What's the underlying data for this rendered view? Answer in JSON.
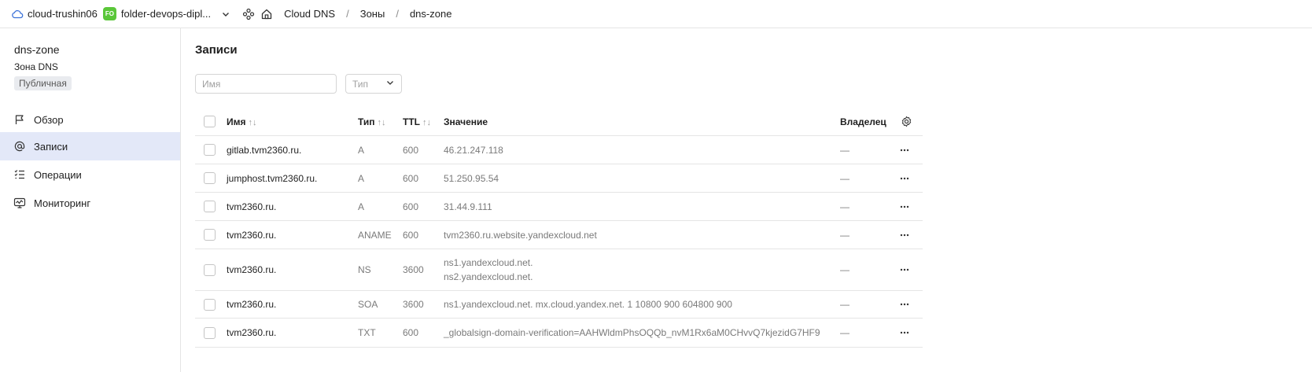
{
  "topbar": {
    "cloud": "cloud-trushin06",
    "folder_badge": "FO",
    "folder": "folder-devops-dipl...",
    "breadcrumbs": [
      "Cloud DNS",
      "Зоны",
      "dns-zone"
    ],
    "separator": "/"
  },
  "sidebar": {
    "zone_title": "dns-zone",
    "zone_subtitle": "Зона DNS",
    "zone_badge": "Публичная",
    "items": [
      {
        "label": "Обзор",
        "icon": "flag-icon"
      },
      {
        "label": "Записи",
        "icon": "at-sign-icon",
        "active": true
      },
      {
        "label": "Операции",
        "icon": "list-check-icon"
      },
      {
        "label": "Мониторинг",
        "icon": "monitor-chart-icon"
      }
    ]
  },
  "main": {
    "title": "Записи",
    "filters": {
      "name_placeholder": "Имя",
      "type_placeholder": "Тип"
    },
    "table": {
      "headers": {
        "name": "Имя",
        "type": "Тип",
        "ttl": "TTL",
        "value": "Значение",
        "owner": "Владелец",
        "sort_glyph": "↑↓"
      },
      "rows": [
        {
          "name": "gitlab.tvm2360.ru.",
          "type": "A",
          "ttl": "600",
          "value": [
            "46.21.247.118"
          ],
          "owner": "—"
        },
        {
          "name": "jumphost.tvm2360.ru.",
          "type": "A",
          "ttl": "600",
          "value": [
            "51.250.95.54"
          ],
          "owner": "—"
        },
        {
          "name": "tvm2360.ru.",
          "type": "A",
          "ttl": "600",
          "value": [
            "31.44.9.111"
          ],
          "owner": "—"
        },
        {
          "name": "tvm2360.ru.",
          "type": "ANAME",
          "ttl": "600",
          "value": [
            "tvm2360.ru.website.yandexcloud.net"
          ],
          "owner": "—"
        },
        {
          "name": "tvm2360.ru.",
          "type": "NS",
          "ttl": "3600",
          "value": [
            "ns1.yandexcloud.net.",
            "ns2.yandexcloud.net."
          ],
          "owner": "—"
        },
        {
          "name": "tvm2360.ru.",
          "type": "SOA",
          "ttl": "3600",
          "value": [
            "ns1.yandexcloud.net. mx.cloud.yandex.net. 1 10800 900 604800 900"
          ],
          "owner": "—"
        },
        {
          "name": "tvm2360.ru.",
          "type": "TXT",
          "ttl": "600",
          "value": [
            "_globalsign-domain-verification=AAHWldmPhsOQQb_nvM1Rx6aM0CHvvQ7kjezidG7HF9"
          ],
          "owner": "—"
        }
      ]
    }
  },
  "colors": {
    "accent_active": "#e3e8f8",
    "folder_badge": "#5ac739",
    "border": "#e5e5e5"
  }
}
